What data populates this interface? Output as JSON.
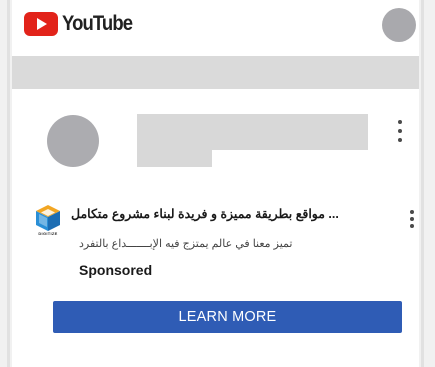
{
  "header": {
    "brand": "YouTube"
  },
  "ad": {
    "title": "... مواقع بطريقة مميزة و فريدة لبناء مشروع متكامل",
    "description": "تميز معنا في عالم يمتزج فيه الإبـــــــداع بالتفرد",
    "sponsored_label": "Sponsored",
    "cta_label": "LEARN MORE",
    "logo_caption": "DIGITIZE"
  },
  "colors": {
    "brand_red": "#e2231a",
    "cta_blue": "#2f5cb5",
    "placeholder_gray": "#d8d8d8"
  }
}
